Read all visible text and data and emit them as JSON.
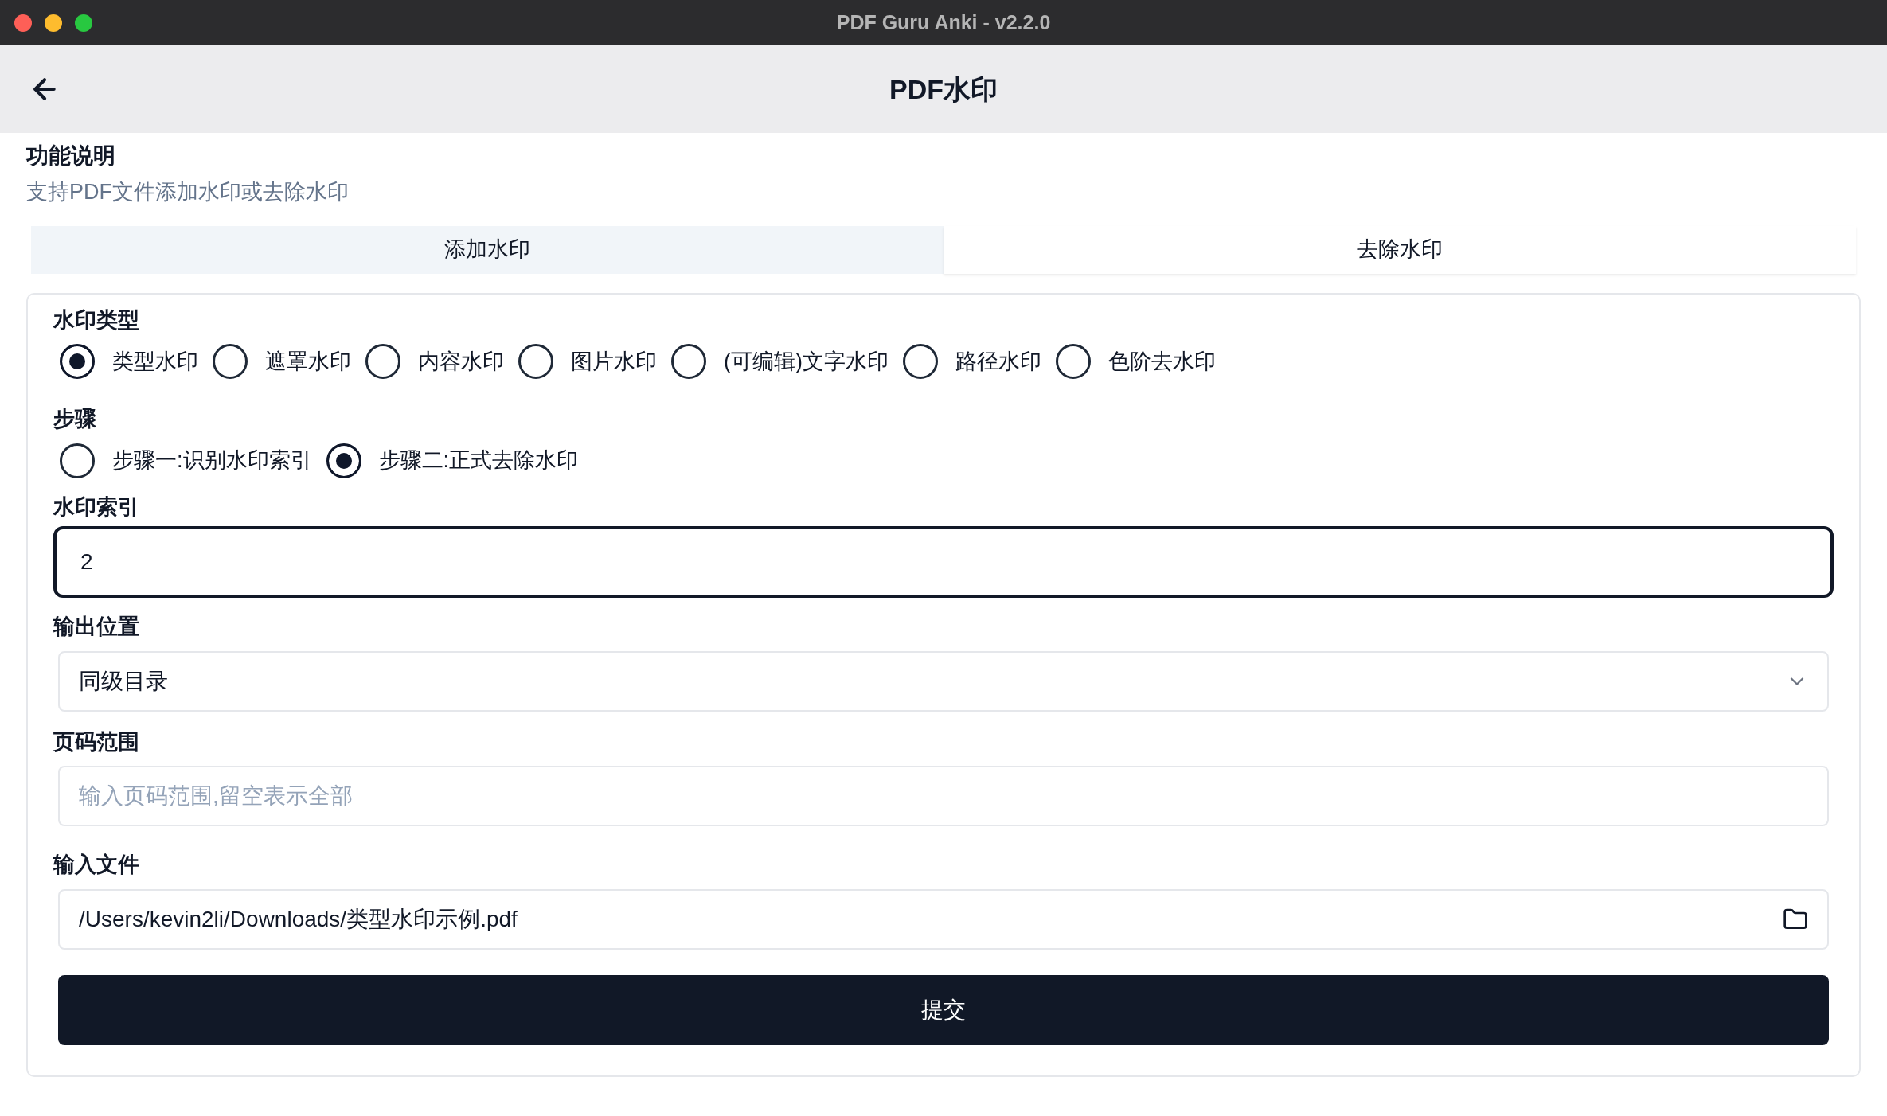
{
  "window": {
    "title": "PDF Guru Anki - v2.2.0"
  },
  "header": {
    "title": "PDF水印"
  },
  "description": {
    "heading": "功能说明",
    "text": "支持PDF文件添加水印或去除水印"
  },
  "tabs": [
    {
      "label": "添加水印",
      "selected": false
    },
    {
      "label": "去除水印",
      "selected": true
    }
  ],
  "form": {
    "watermark_type": {
      "label": "水印类型",
      "options": [
        {
          "label": "类型水印",
          "selected": true
        },
        {
          "label": "遮罩水印",
          "selected": false
        },
        {
          "label": "内容水印",
          "selected": false
        },
        {
          "label": "图片水印",
          "selected": false
        },
        {
          "label": "(可编辑)文字水印",
          "selected": false
        },
        {
          "label": "路径水印",
          "selected": false
        },
        {
          "label": "色阶去水印",
          "selected": false
        }
      ]
    },
    "step": {
      "label": "步骤",
      "options": [
        {
          "label": "步骤一:识别水印索引",
          "selected": false
        },
        {
          "label": "步骤二:正式去除水印",
          "selected": true
        }
      ]
    },
    "watermark_index": {
      "label": "水印索引",
      "value": "2"
    },
    "output": {
      "label": "输出位置",
      "value": "同级目录"
    },
    "page_range": {
      "label": "页码范围",
      "placeholder": "输入页码范围,留空表示全部"
    },
    "input_file": {
      "label": "输入文件",
      "value": "/Users/kevin2li/Downloads/类型水印示例.pdf"
    },
    "submit": "提交"
  }
}
